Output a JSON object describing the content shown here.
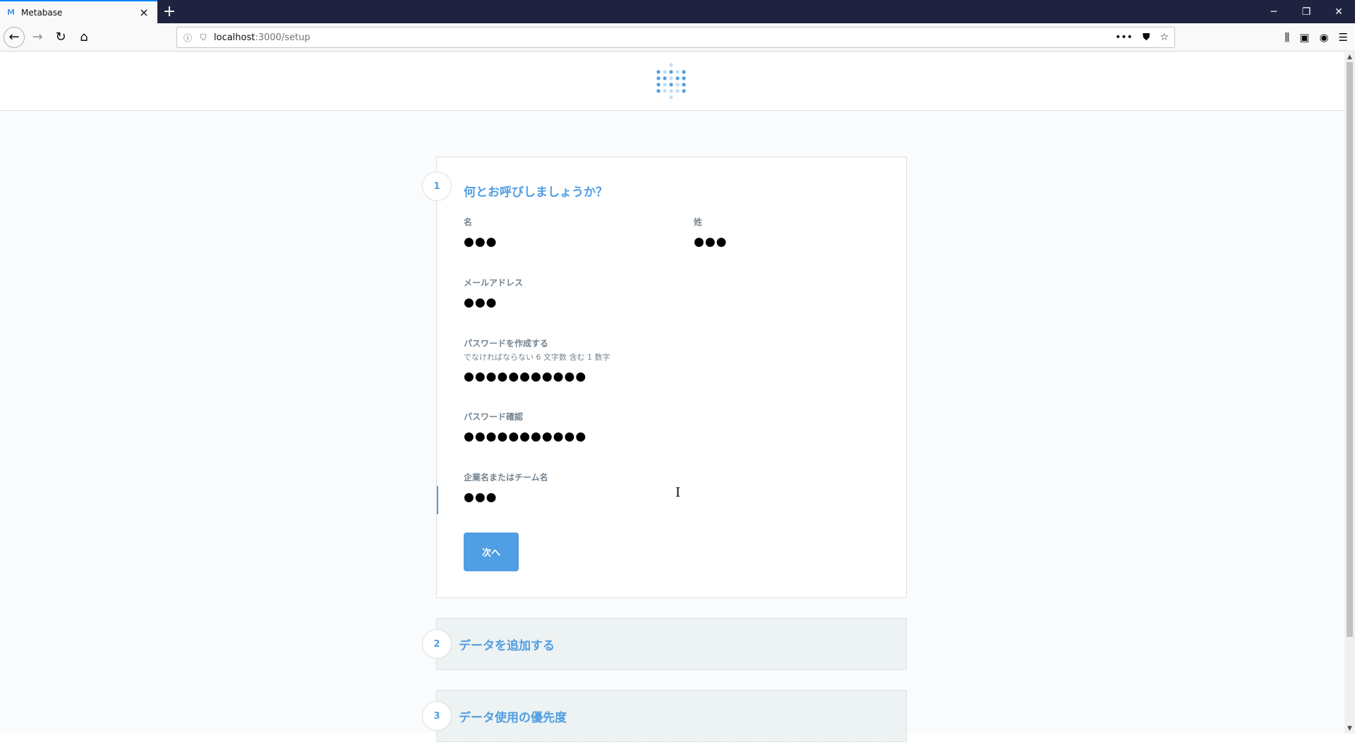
{
  "browser": {
    "tab_title": "Metabase",
    "tab_favicon": "M",
    "new_tab_icon": "+",
    "url_host": "localhost",
    "url_path": ":3000/setup",
    "window_controls": {
      "minimize": "─",
      "restore": "❐",
      "close": "✕"
    }
  },
  "setup": {
    "step1": {
      "number": "1",
      "title": "何とお呼びしましょうか？",
      "first_name": {
        "label": "名",
        "value": "●●●"
      },
      "last_name": {
        "label": "姓",
        "value": "●●●"
      },
      "email": {
        "label": "メールアドレス",
        "value": "●●●"
      },
      "password": {
        "label": "パスワードを作成する",
        "hint": "でなければならない 6 文字数 含む 1 数字",
        "value": "●●●●●●●●●●●"
      },
      "password_confirm": {
        "label": "パスワード確認",
        "value": "●●●●●●●●●●●"
      },
      "company": {
        "label": "企業名またはチーム名",
        "value": "●●●"
      },
      "next_button": "次へ"
    },
    "step2": {
      "number": "2",
      "title": "データを追加する"
    },
    "step3": {
      "number": "3",
      "title": "データ使用の優先度"
    }
  },
  "colors": {
    "brand": "#509ee3",
    "page_bg": "#f9fbfc",
    "chrome_dark": "#202340"
  }
}
